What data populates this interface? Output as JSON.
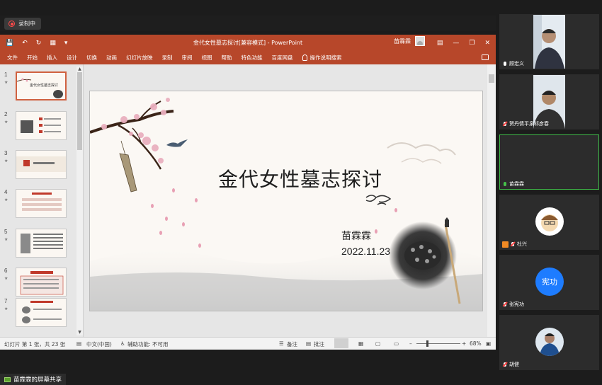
{
  "recording": {
    "label": "录制中"
  },
  "ppt": {
    "doc_title": "金代女性墓志探讨[兼容模式] - PowerPoint",
    "user": "苗霖霖",
    "tabs": [
      "文件",
      "开始",
      "插入",
      "设计",
      "切换",
      "动画",
      "幻灯片放映",
      "录制",
      "审阅",
      "视图",
      "帮助",
      "特色功能",
      "百度网盘"
    ],
    "tell_me": "操作说明搜索"
  },
  "thumbnails": [
    {
      "num": "1",
      "title": "金代女性墓志探讨"
    },
    {
      "num": "2",
      "title": ""
    },
    {
      "num": "3",
      "title": ""
    },
    {
      "num": "4",
      "title": ""
    },
    {
      "num": "5",
      "title": ""
    },
    {
      "num": "6",
      "title": ""
    },
    {
      "num": "7",
      "title": ""
    }
  ],
  "slide": {
    "title": "金代女性墓志探讨",
    "author": "苗霖霖",
    "date": "2022.11.23"
  },
  "status": {
    "slide_info": "幻灯片 第 1 张，共 23 张",
    "language": "中文(中国)",
    "accessibility": "辅助功能: 不可用",
    "notes": "备注",
    "comments": "批注",
    "zoom": "68%"
  },
  "share_banner": "苗霖霖的屏幕共享",
  "participants": [
    {
      "name": "顾宏义",
      "mic": "on",
      "kind": "video"
    },
    {
      "name": "贺丹情平泉祁彦春",
      "mic": "muted",
      "kind": "video"
    },
    {
      "name": "苗霖霖",
      "mic": "green",
      "kind": "empty",
      "active": true
    },
    {
      "name": "杜兴",
      "mic": "muted",
      "kind": "avatar-cartoon",
      "host": true
    },
    {
      "name": "张宪功",
      "mic": "muted",
      "kind": "initials",
      "initials": "宪功"
    },
    {
      "name": "胡健",
      "mic": "muted",
      "kind": "avatar-photo"
    }
  ],
  "colors": {
    "ppt_red": "#b7472a",
    "active_green": "#3fbb49",
    "initials_blue": "#1e7cff"
  }
}
